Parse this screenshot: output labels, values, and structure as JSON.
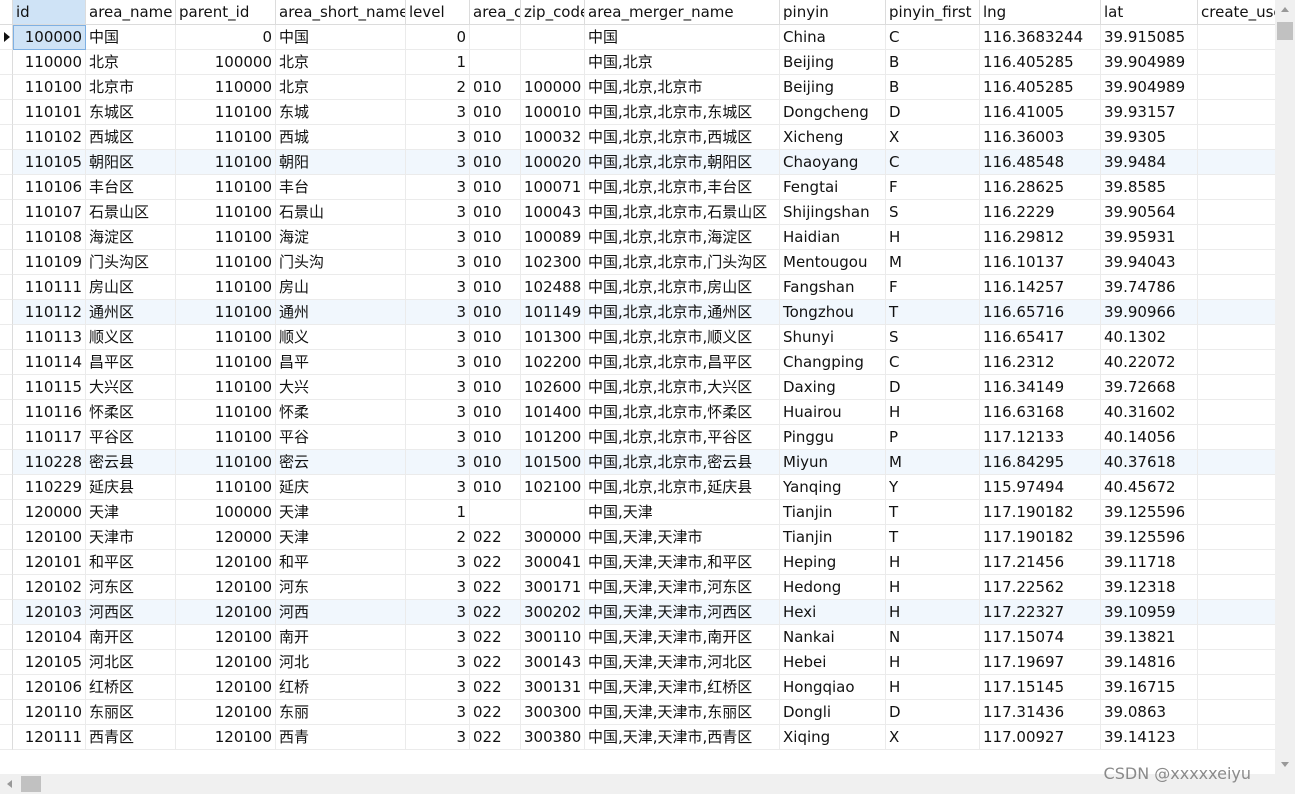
{
  "table": {
    "columns": [
      "id",
      "area_name",
      "parent_id",
      "area_short_name",
      "level",
      "area_c",
      "zip_code",
      "area_merger_name",
      "pinyin",
      "pinyin_first",
      "lng",
      "lat",
      "create_use"
    ],
    "rows": [
      [
        "100000",
        "中国",
        "0",
        "中国",
        "0",
        "",
        "",
        "中国",
        "China",
        "C",
        "116.3683244",
        "39.915085",
        ""
      ],
      [
        "110000",
        "北京",
        "100000",
        "北京",
        "1",
        "",
        "",
        "中国,北京",
        "Beijing",
        "B",
        "116.405285",
        "39.904989",
        ""
      ],
      [
        "110100",
        "北京市",
        "110000",
        "北京",
        "2",
        "010",
        "100000",
        "中国,北京,北京市",
        "Beijing",
        "B",
        "116.405285",
        "39.904989",
        ""
      ],
      [
        "110101",
        "东城区",
        "110100",
        "东城",
        "3",
        "010",
        "100010",
        "中国,北京,北京市,东城区",
        "Dongcheng",
        "D",
        "116.41005",
        "39.93157",
        ""
      ],
      [
        "110102",
        "西城区",
        "110100",
        "西城",
        "3",
        "010",
        "100032",
        "中国,北京,北京市,西城区",
        "Xicheng",
        "X",
        "116.36003",
        "39.9305",
        ""
      ],
      [
        "110105",
        "朝阳区",
        "110100",
        "朝阳",
        "3",
        "010",
        "100020",
        "中国,北京,北京市,朝阳区",
        "Chaoyang",
        "C",
        "116.48548",
        "39.9484",
        ""
      ],
      [
        "110106",
        "丰台区",
        "110100",
        "丰台",
        "3",
        "010",
        "100071",
        "中国,北京,北京市,丰台区",
        "Fengtai",
        "F",
        "116.28625",
        "39.8585",
        ""
      ],
      [
        "110107",
        "石景山区",
        "110100",
        "石景山",
        "3",
        "010",
        "100043",
        "中国,北京,北京市,石景山区",
        "Shijingshan",
        "S",
        "116.2229",
        "39.90564",
        ""
      ],
      [
        "110108",
        "海淀区",
        "110100",
        "海淀",
        "3",
        "010",
        "100089",
        "中国,北京,北京市,海淀区",
        "Haidian",
        "H",
        "116.29812",
        "39.95931",
        ""
      ],
      [
        "110109",
        "门头沟区",
        "110100",
        "门头沟",
        "3",
        "010",
        "102300",
        "中国,北京,北京市,门头沟区",
        "Mentougou",
        "M",
        "116.10137",
        "39.94043",
        ""
      ],
      [
        "110111",
        "房山区",
        "110100",
        "房山",
        "3",
        "010",
        "102488",
        "中国,北京,北京市,房山区",
        "Fangshan",
        "F",
        "116.14257",
        "39.74786",
        ""
      ],
      [
        "110112",
        "通州区",
        "110100",
        "通州",
        "3",
        "010",
        "101149",
        "中国,北京,北京市,通州区",
        "Tongzhou",
        "T",
        "116.65716",
        "39.90966",
        ""
      ],
      [
        "110113",
        "顺义区",
        "110100",
        "顺义",
        "3",
        "010",
        "101300",
        "中国,北京,北京市,顺义区",
        "Shunyi",
        "S",
        "116.65417",
        "40.1302",
        ""
      ],
      [
        "110114",
        "昌平区",
        "110100",
        "昌平",
        "3",
        "010",
        "102200",
        "中国,北京,北京市,昌平区",
        "Changping",
        "C",
        "116.2312",
        "40.22072",
        ""
      ],
      [
        "110115",
        "大兴区",
        "110100",
        "大兴",
        "3",
        "010",
        "102600",
        "中国,北京,北京市,大兴区",
        "Daxing",
        "D",
        "116.34149",
        "39.72668",
        ""
      ],
      [
        "110116",
        "怀柔区",
        "110100",
        "怀柔",
        "3",
        "010",
        "101400",
        "中国,北京,北京市,怀柔区",
        "Huairou",
        "H",
        "116.63168",
        "40.31602",
        ""
      ],
      [
        "110117",
        "平谷区",
        "110100",
        "平谷",
        "3",
        "010",
        "101200",
        "中国,北京,北京市,平谷区",
        "Pinggu",
        "P",
        "117.12133",
        "40.14056",
        ""
      ],
      [
        "110228",
        "密云县",
        "110100",
        "密云",
        "3",
        "010",
        "101500",
        "中国,北京,北京市,密云县",
        "Miyun",
        "M",
        "116.84295",
        "40.37618",
        ""
      ],
      [
        "110229",
        "延庆县",
        "110100",
        "延庆",
        "3",
        "010",
        "102100",
        "中国,北京,北京市,延庆县",
        "Yanqing",
        "Y",
        "115.97494",
        "40.45672",
        ""
      ],
      [
        "120000",
        "天津",
        "100000",
        "天津",
        "1",
        "",
        "",
        "中国,天津",
        "Tianjin",
        "T",
        "117.190182",
        "39.125596",
        ""
      ],
      [
        "120100",
        "天津市",
        "120000",
        "天津",
        "2",
        "022",
        "300000",
        "中国,天津,天津市",
        "Tianjin",
        "T",
        "117.190182",
        "39.125596",
        ""
      ],
      [
        "120101",
        "和平区",
        "120100",
        "和平",
        "3",
        "022",
        "300041",
        "中国,天津,天津市,和平区",
        "Heping",
        "H",
        "117.21456",
        "39.11718",
        ""
      ],
      [
        "120102",
        "河东区",
        "120100",
        "河东",
        "3",
        "022",
        "300171",
        "中国,天津,天津市,河东区",
        "Hedong",
        "H",
        "117.22562",
        "39.12318",
        ""
      ],
      [
        "120103",
        "河西区",
        "120100",
        "河西",
        "3",
        "022",
        "300202",
        "中国,天津,天津市,河西区",
        "Hexi",
        "H",
        "117.22327",
        "39.10959",
        ""
      ],
      [
        "120104",
        "南开区",
        "120100",
        "南开",
        "3",
        "022",
        "300110",
        "中国,天津,天津市,南开区",
        "Nankai",
        "N",
        "117.15074",
        "39.13821",
        ""
      ],
      [
        "120105",
        "河北区",
        "120100",
        "河北",
        "3",
        "022",
        "300143",
        "中国,天津,天津市,河北区",
        "Hebei",
        "H",
        "117.19697",
        "39.14816",
        ""
      ],
      [
        "120106",
        "红桥区",
        "120100",
        "红桥",
        "3",
        "022",
        "300131",
        "中国,天津,天津市,红桥区",
        "Hongqiao",
        "H",
        "117.15145",
        "39.16715",
        ""
      ],
      [
        "120110",
        "东丽区",
        "120100",
        "东丽",
        "3",
        "022",
        "300300",
        "中国,天津,天津市,东丽区",
        "Dongli",
        "D",
        "117.31436",
        "39.0863",
        ""
      ],
      [
        "120111",
        "西青区",
        "120100",
        "西青",
        "3",
        "022",
        "300380",
        "中国,天津,天津市,西青区",
        "Xiqing",
        "X",
        "117.00927",
        "39.14123",
        ""
      ]
    ],
    "striped_rows": [
      5,
      11,
      17,
      23
    ]
  },
  "watermark": "CSDN @xxxxxeiyu"
}
